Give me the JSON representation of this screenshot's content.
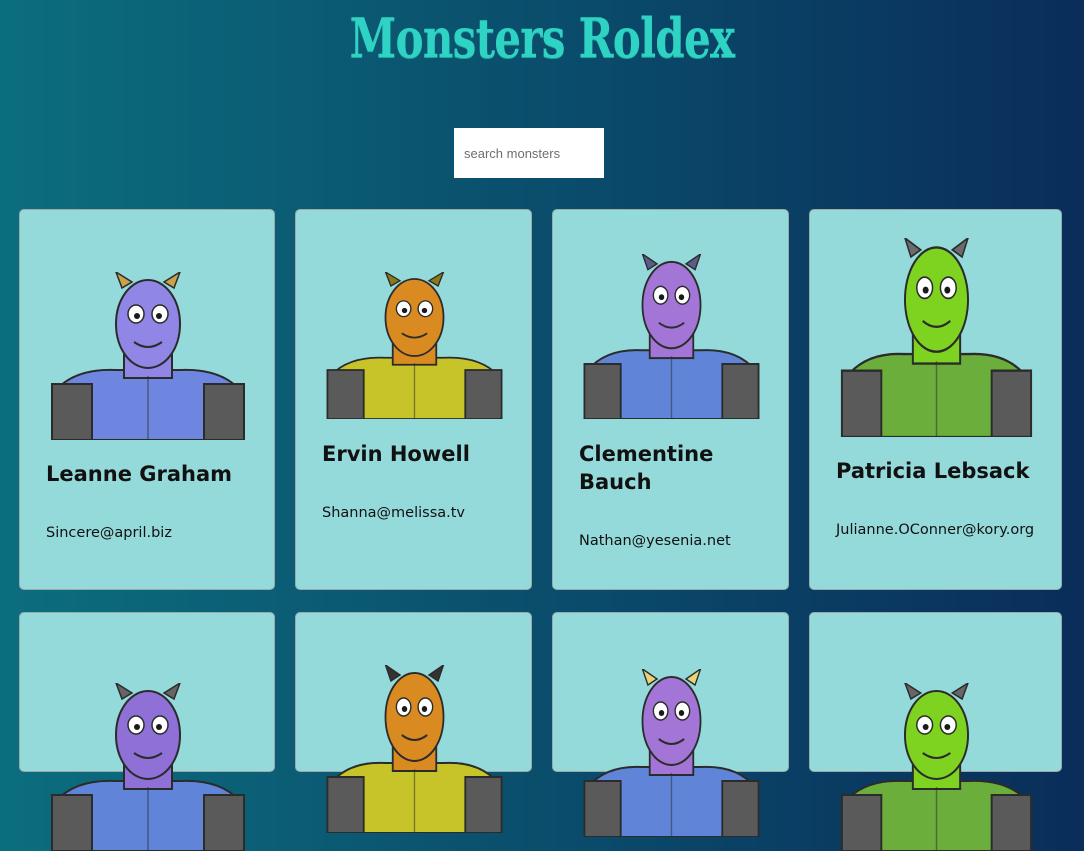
{
  "app": {
    "title": "Monsters Roldex"
  },
  "search": {
    "placeholder": "search monsters",
    "value": ""
  },
  "monsters": [
    {
      "name": "Leanne Graham",
      "email": "Sincere@april.biz",
      "body_color": "#6f86e0",
      "face_color": "#8f86e6",
      "accent_color": "#c9a24a",
      "icon": "horned-monster-avatar"
    },
    {
      "name": "Ervin Howell",
      "email": "Shanna@melissa.tv",
      "body_color": "#c7c42a",
      "face_color": "#d98b22",
      "accent_color": "#8a7a18",
      "icon": "masked-monster-avatar"
    },
    {
      "name": "Clementine Bauch",
      "email": "Nathan@yesenia.net",
      "body_color": "#5f84d8",
      "face_color": "#a275d6",
      "accent_color": "#5c5c8a",
      "icon": "cyclops-monster-avatar"
    },
    {
      "name": "Patricia Lebsack",
      "email": "Julianne.OConner@kory.org",
      "body_color": "#6cae3c",
      "face_color": "#7ed321",
      "accent_color": "#6b6b6b",
      "icon": "robot-monster-avatar"
    },
    {
      "name": "",
      "email": "",
      "body_color": "#5f84d8",
      "face_color": "#8f70d6",
      "accent_color": "#666666",
      "icon": "monster-avatar"
    },
    {
      "name": "",
      "email": "",
      "body_color": "#c7c42a",
      "face_color": "#d98b22",
      "accent_color": "#333333",
      "icon": "monster-avatar"
    },
    {
      "name": "",
      "email": "",
      "body_color": "#5f84d8",
      "face_color": "#a275d6",
      "accent_color": "#e8d27a",
      "icon": "monster-avatar"
    },
    {
      "name": "",
      "email": "",
      "body_color": "#6cae3c",
      "face_color": "#7ed321",
      "accent_color": "#666666",
      "icon": "monster-avatar"
    }
  ]
}
